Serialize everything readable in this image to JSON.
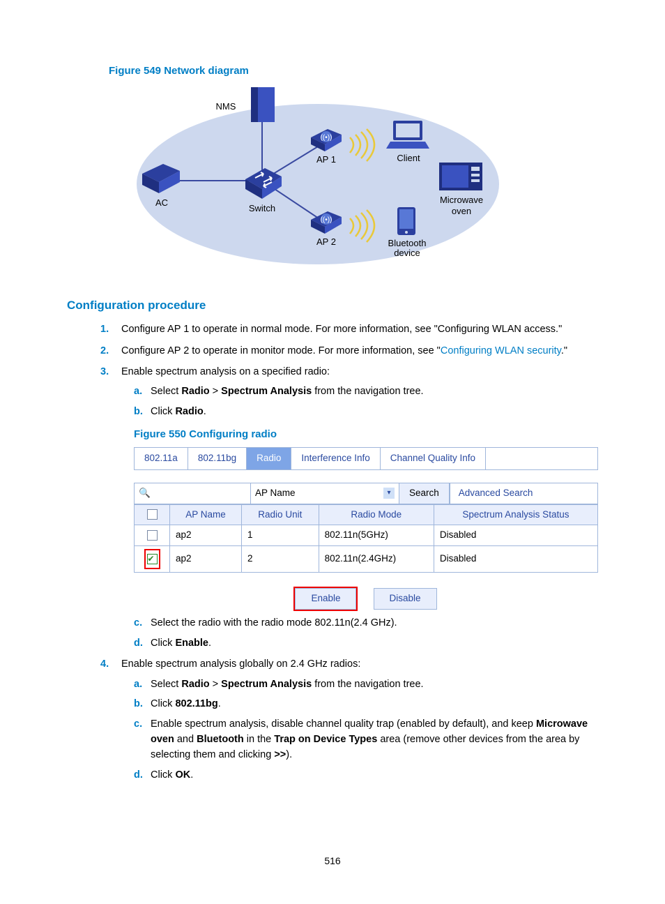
{
  "figure1": {
    "caption": "Figure 549 Network diagram",
    "labels": {
      "nms": "NMS",
      "ac": "AC",
      "switch": "Switch",
      "ap1": "AP 1",
      "ap2": "AP 2",
      "client": "Client",
      "bt": "Bluetooth\ndevice",
      "mw1": "Microwave",
      "mw2": "oven"
    }
  },
  "section_heading": "Configuration procedure",
  "step1": {
    "num": "1.",
    "text_a": "Configure AP 1 to operate in normal mode. For more information, see \"Configuring WLAN access.\""
  },
  "step2": {
    "num": "2.",
    "text_a": "Configure AP 2 to operate in monitor mode. For more information, see \"",
    "link": "Configuring WLAN security",
    "text_b": ".\""
  },
  "step3": {
    "num": "3.",
    "text": "Enable spectrum analysis on a specified radio:",
    "a": {
      "l": "a.",
      "pre": "Select ",
      "b1": "Radio",
      "mid": " > ",
      "b2": "Spectrum Analysis",
      "post": " from the navigation tree."
    },
    "b": {
      "l": "b.",
      "pre": "Click ",
      "b1": "Radio",
      "post": "."
    },
    "figcap": "Figure 550 Configuring radio",
    "c": {
      "l": "c.",
      "text": "Select the radio with the radio mode 802.11n(2.4 GHz)."
    },
    "d": {
      "l": "d.",
      "pre": "Click ",
      "b1": "Enable",
      "post": "."
    }
  },
  "step4": {
    "num": "4.",
    "text": "Enable spectrum analysis globally on 2.4 GHz radios:",
    "a": {
      "l": "a.",
      "pre": "Select ",
      "b1": "Radio",
      "mid": " > ",
      "b2": "Spectrum Analysis",
      "post": " from the navigation tree."
    },
    "b": {
      "l": "b.",
      "pre": "Click ",
      "b1": "802.11bg",
      "post": "."
    },
    "c": {
      "l": "c.",
      "pre": "Enable spectrum analysis, disable channel quality trap (enabled by default), and keep ",
      "b1": "Microwave oven",
      "mid1": " and ",
      "b2": "Bluetooth",
      "mid2": " in the ",
      "b3": "Trap on Device Types",
      "mid3": " area (remove other devices from the area by selecting them and clicking ",
      "b4": ">>",
      "post": ")."
    },
    "d": {
      "l": "d.",
      "pre": "Click ",
      "b1": "OK",
      "post": "."
    }
  },
  "ui": {
    "tabs": {
      "t1": "802.11a",
      "t2": "802.11bg",
      "t3": "Radio",
      "t4": "Interference Info",
      "t5": "Channel Quality Info"
    },
    "search": {
      "field": "AP Name",
      "btn": "Search",
      "adv": "Advanced Search"
    },
    "headers": {
      "h1": "AP Name",
      "h2": "Radio Unit",
      "h3": "Radio Mode",
      "h4": "Spectrum Analysis Status"
    },
    "rows": [
      {
        "ap": "ap2",
        "unit": "1",
        "mode": "802.11n(5GHz)",
        "status": "Disabled",
        "checked": false
      },
      {
        "ap": "ap2",
        "unit": "2",
        "mode": "802.11n(2.4GHz)",
        "status": "Disabled",
        "checked": true
      }
    ],
    "enable": "Enable",
    "disable": "Disable"
  },
  "page_number": "516"
}
